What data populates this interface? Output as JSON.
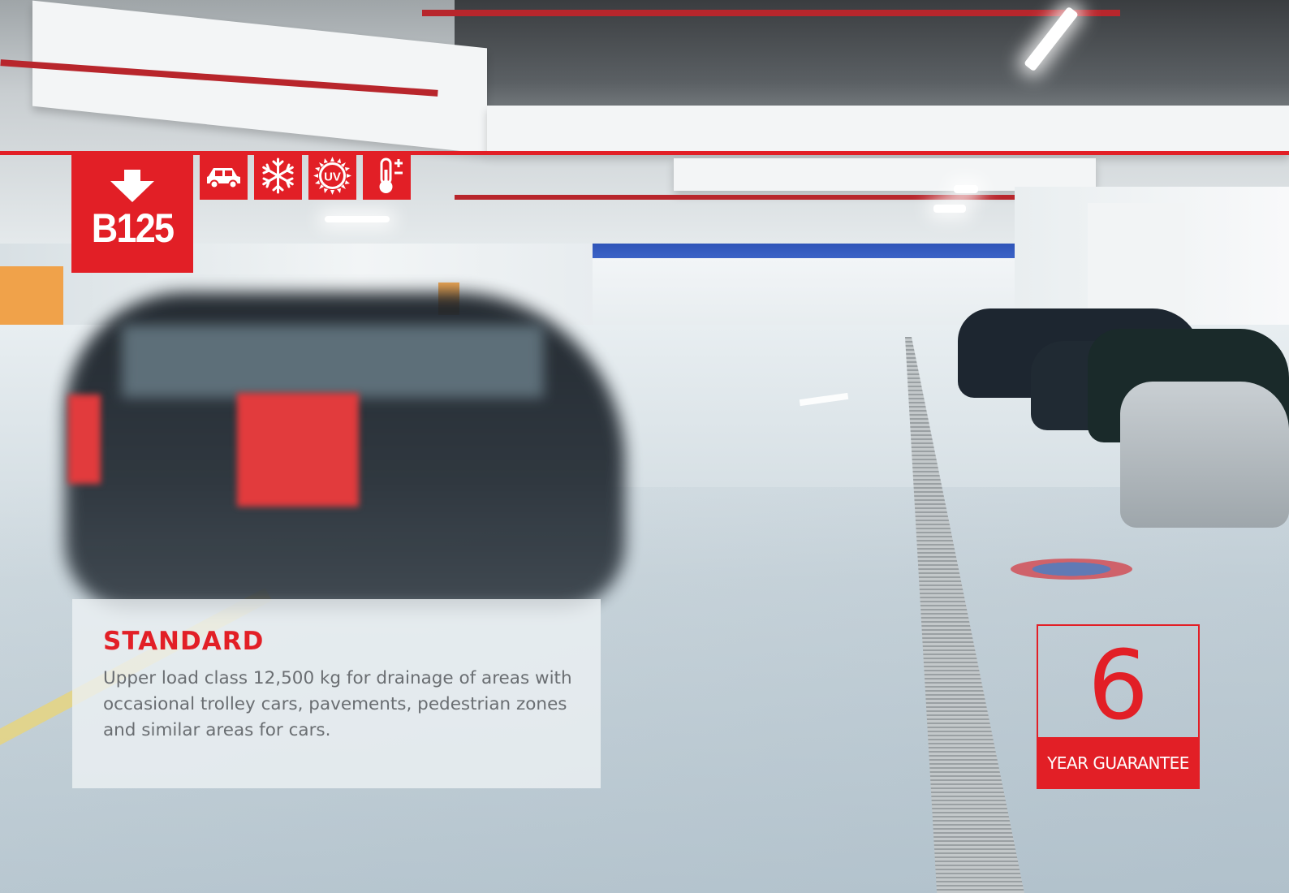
{
  "load_class": {
    "code": "B125"
  },
  "icons": [
    {
      "name": "car-icon",
      "color": "#e21f26"
    },
    {
      "name": "snowflake-icon",
      "color": "#e21f26"
    },
    {
      "name": "uv-icon",
      "label": "UV",
      "color": "#e21f26"
    },
    {
      "name": "thermometer-icon",
      "color": "#e21f26"
    }
  ],
  "info": {
    "title": "STANDARD",
    "description": "Upper load class 12,500 kg for drainage of areas with occasional trolley cars, pavements, pedestrian zones and similar areas for cars."
  },
  "guarantee": {
    "years": "6",
    "label": "YEAR GUARANTEE"
  },
  "colors": {
    "brand_red": "#e21f26",
    "body_text": "#6a6e72"
  }
}
